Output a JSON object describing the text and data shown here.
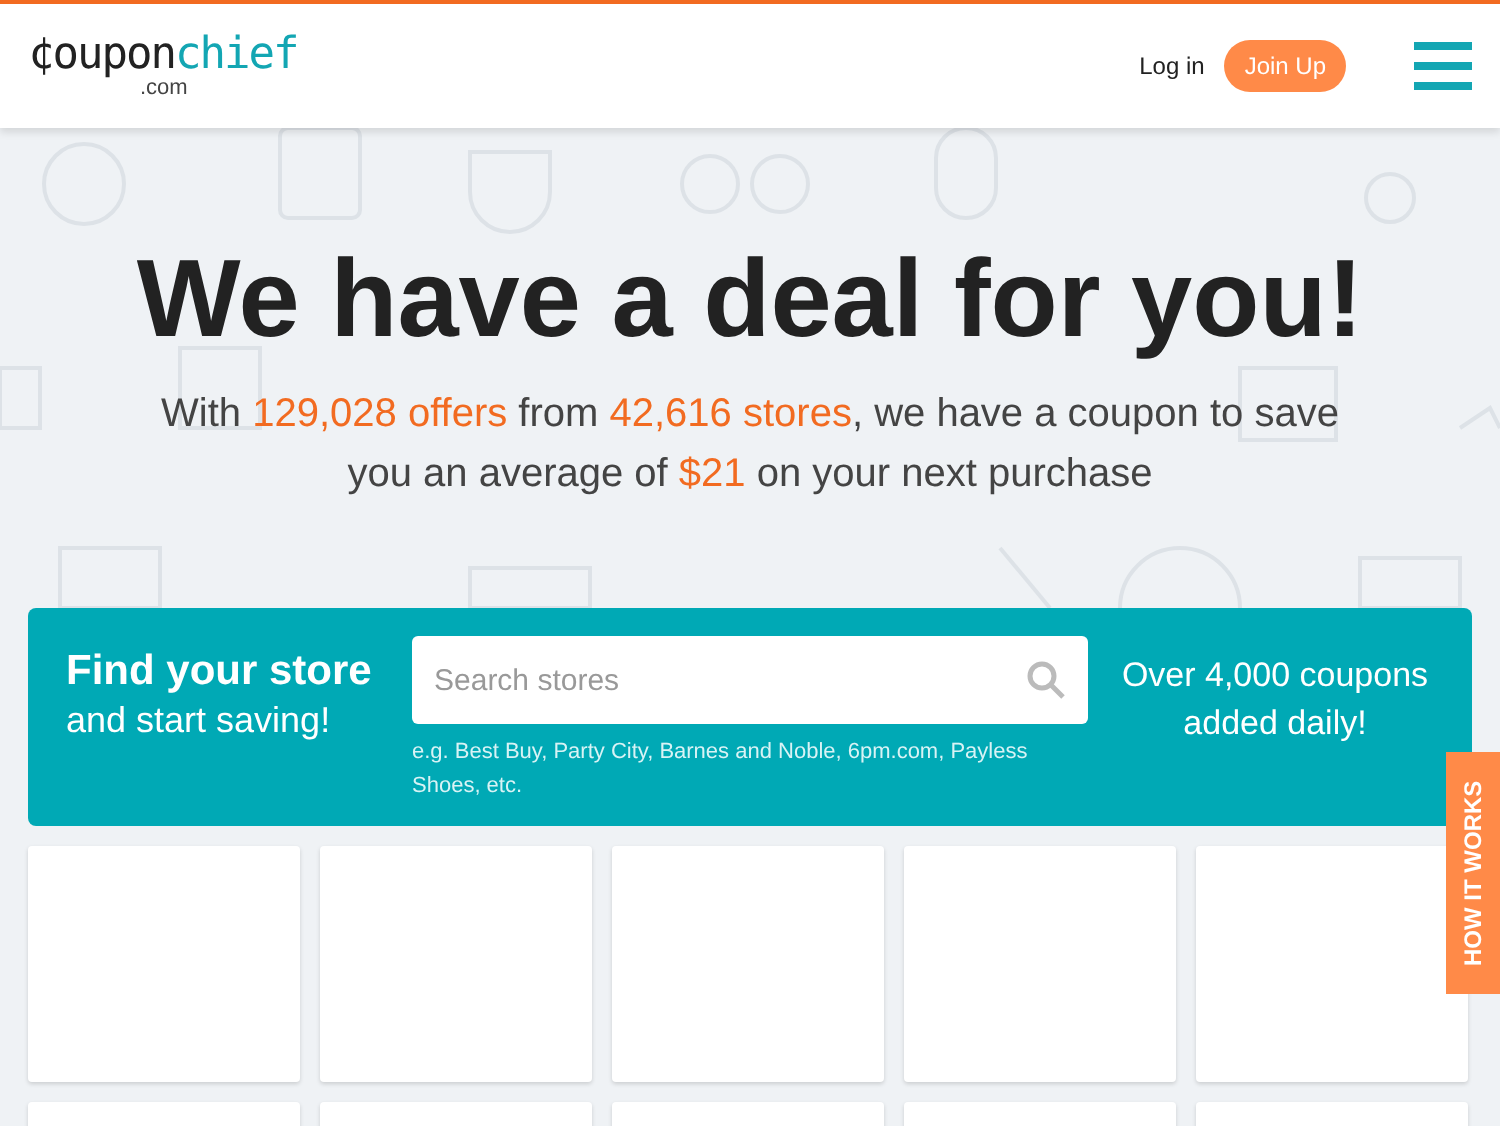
{
  "header": {
    "logo": {
      "main": "¢oupon",
      "accent": "chief",
      "suffix": ".com"
    },
    "login": "Log in",
    "join": "Join Up"
  },
  "hero": {
    "title": "We have a deal for you!",
    "subtitle": [
      {
        "text": "With ",
        "highlight": false
      },
      {
        "text": "129,028 offers",
        "highlight": true
      },
      {
        "text": " from ",
        "highlight": false
      },
      {
        "text": "42,616 stores",
        "highlight": true
      },
      {
        "text": ", we have a coupon to save you an average of ",
        "highlight": false
      },
      {
        "text": "$21",
        "highlight": true
      },
      {
        "text": " on your next purchase",
        "highlight": false
      }
    ]
  },
  "search": {
    "heading": "Find your store",
    "subheading": "and start saving!",
    "placeholder": "Search stores",
    "hint": "e.g. Best Buy, Party City, Barnes and Noble, 6pm.com, Payless Shoes, etc.",
    "promo": "Over 4,000 coupons added daily!"
  },
  "side_tab": "HOW IT WORKS"
}
